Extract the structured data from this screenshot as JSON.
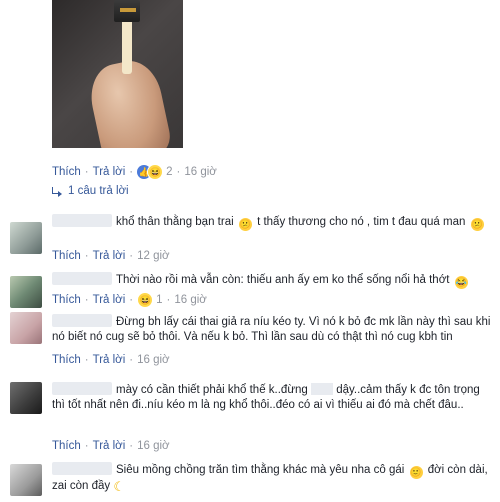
{
  "post_actions": {
    "like": "Thích",
    "reply": "Trả lời",
    "reaction_count": "2",
    "time": "16 giờ"
  },
  "reply_toggle": "1 câu trả lời",
  "comments": [
    {
      "text_before": "khổ thân thằng bạn trai",
      "text_mid": "t thấy thương cho nó , tim t đau quá man",
      "like": "Thích",
      "reply": "Trả lời",
      "time": "12 giờ"
    },
    {
      "text": "Thời nào rồi mà vẫn còn: thiếu anh ấy em ko thể sống nổi hả thớt",
      "like": "Thích",
      "reply": "Trả lời",
      "reaction_count": "1",
      "time": "16 giờ"
    },
    {
      "text": "Đừng bh lấy cái thai giả ra níu kéo ty. Vì nó k bỏ đc mk lần này thì sau khi nó biết nó cug sẽ bỏ thôi. Và nếu k bỏ. Thì lần sau dù có thật thì nó cug kbh tin",
      "like": "Thích",
      "reply": "Trả lời",
      "time": "16 giờ"
    },
    {
      "text_a": "mày có cần thiết phải khổ thế k..đừng",
      "text_b": "dậy..cảm thấy k đc tôn trọng thì tốt nhất nên đi..níu kéo m là ng khổ thôi..đéo có ai vì thiếu ai đó mà chết đâu..",
      "like": "Thích",
      "reply": "Trả lời",
      "time": "16 giờ"
    },
    {
      "text_a": "Siêu mồng chồng trăn tìm thằng khác mà yêu nha cô gái",
      "text_b": "đời còn dài, zai còn đầy"
    }
  ]
}
